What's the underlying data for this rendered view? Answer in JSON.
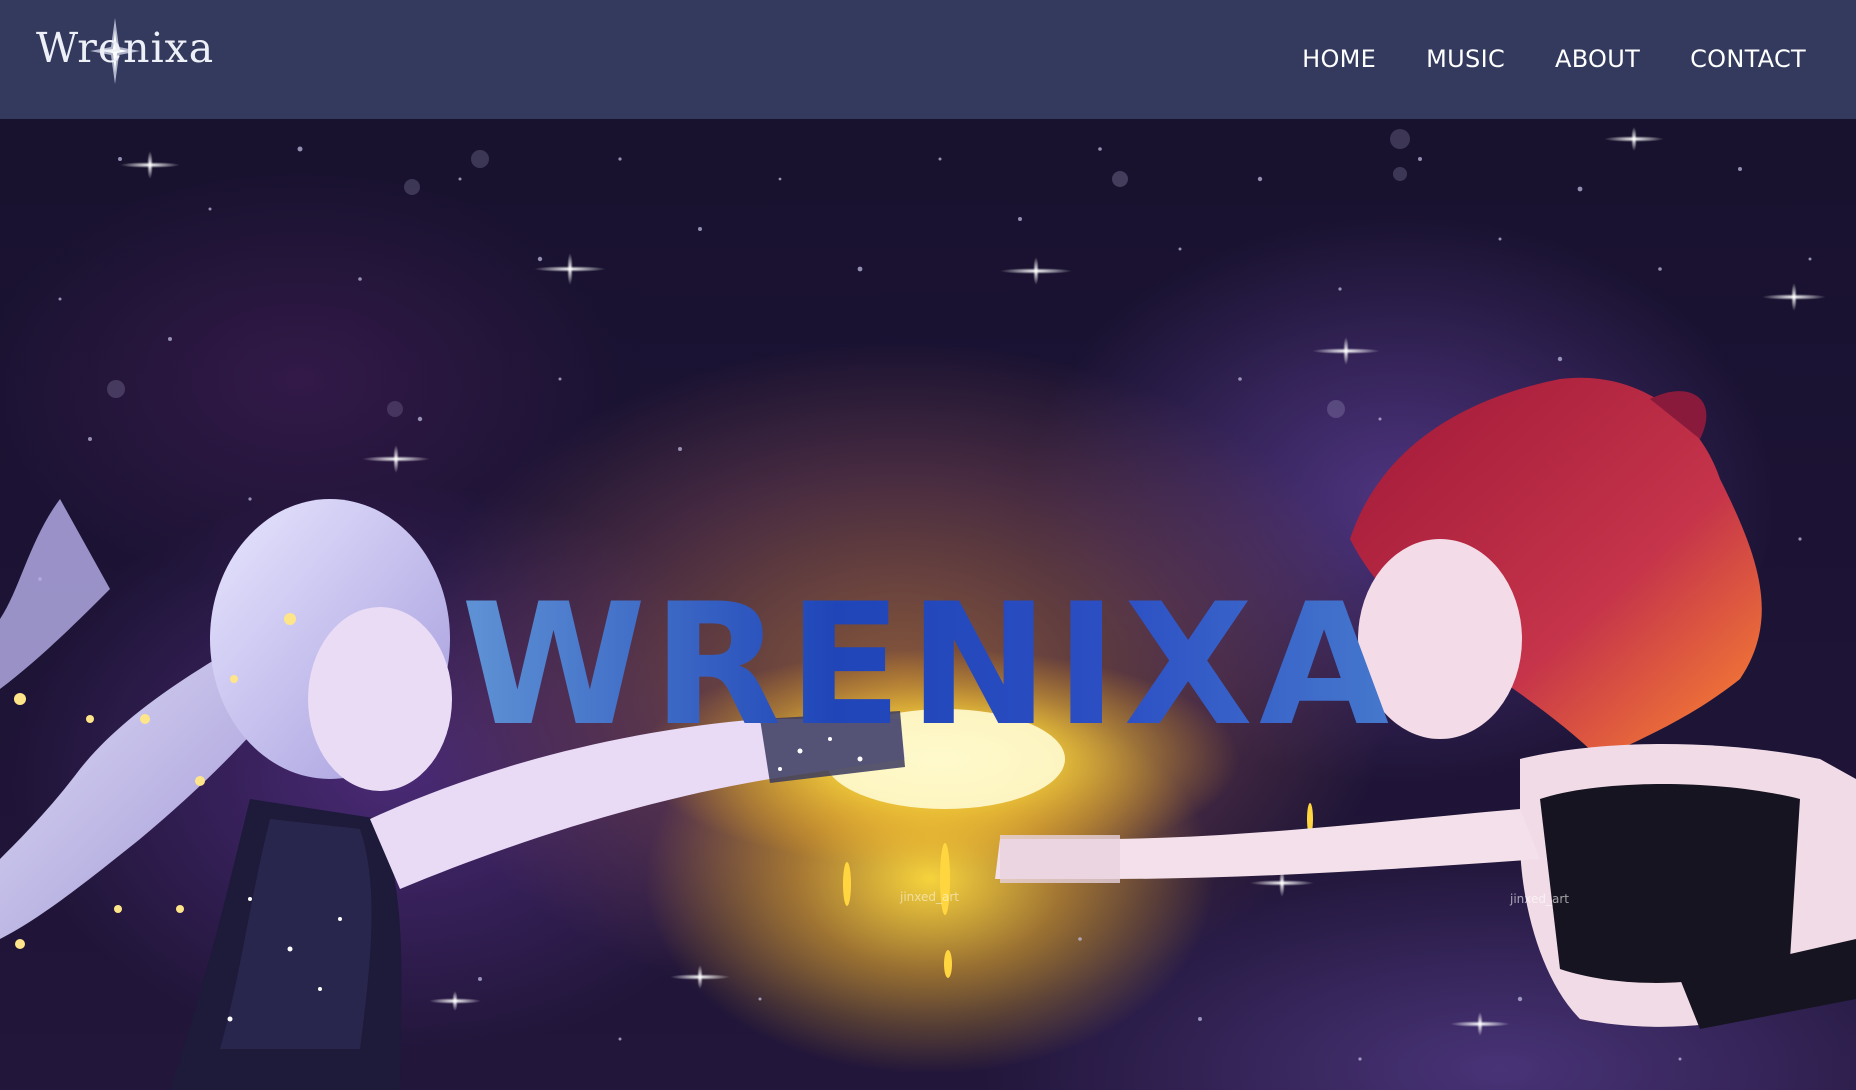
{
  "header": {
    "logo_text": "Wrenixa",
    "logo_icon": "compass-star-icon",
    "nav": [
      {
        "label": "HOME"
      },
      {
        "label": "MUSIC"
      },
      {
        "label": "ABOUT"
      },
      {
        "label": "CONTACT"
      }
    ]
  },
  "hero": {
    "title": "WRENIXA",
    "artist_signature": "jinxed_art"
  },
  "colors": {
    "header_bg": "#333a5e",
    "nav_text": "#ffffff",
    "title_gradient_light": "#8fc6e4",
    "title_gradient_dark": "#1f45b8",
    "glow": "#ffdc3c"
  }
}
